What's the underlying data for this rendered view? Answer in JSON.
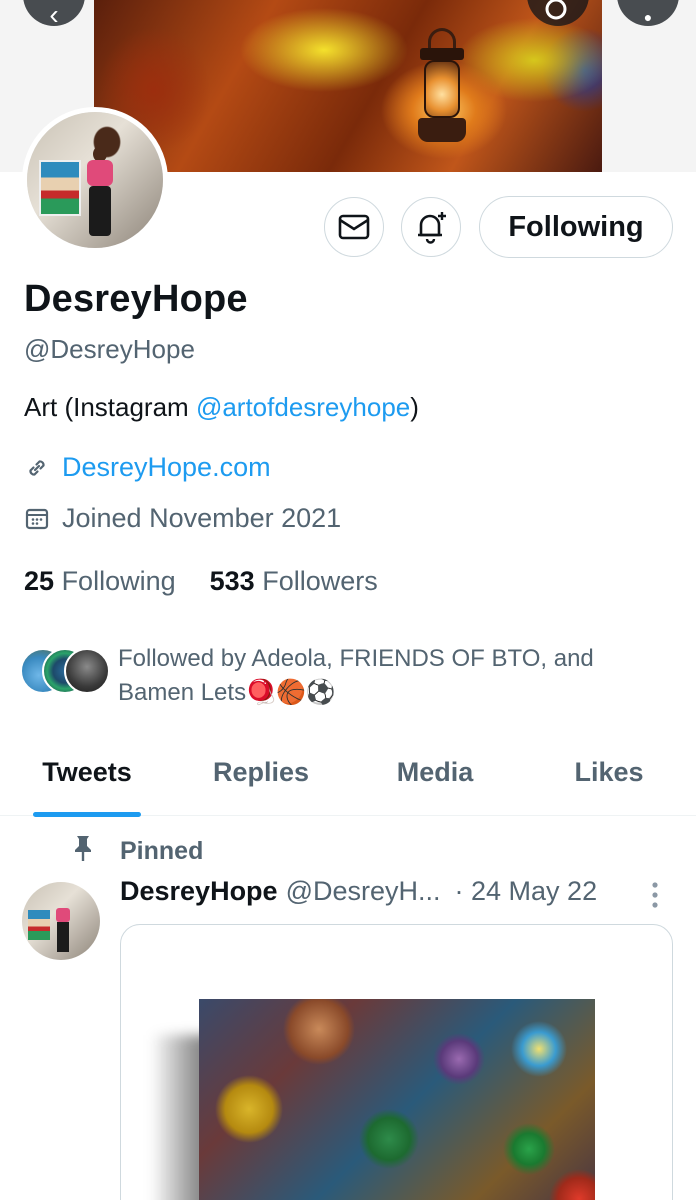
{
  "profile": {
    "display_name": "DesreyHope",
    "handle": "@DesreyHope",
    "bio_prefix": "Art (Instagram ",
    "bio_link": "@artofdesreyhope",
    "bio_suffix": ")",
    "website": "DesreyHope.com",
    "joined": "Joined November 2021",
    "following_count": "25",
    "following_label": "Following",
    "followers_count": "533",
    "followers_label": "Followers",
    "followed_by": "Followed by Adeola, FRIENDS OF BTO, and Bamen Lets🪀🏀⚽",
    "follow_button_label": "Following"
  },
  "icons": {
    "back": "back-arrow-icon",
    "search": "search-icon",
    "more": "more-icon",
    "message": "envelope-icon",
    "notify": "bell-plus-icon",
    "link": "link-icon",
    "calendar": "calendar-icon",
    "pin": "pin-icon",
    "tweet_more": "vertical-dots-icon"
  },
  "tabs": [
    {
      "label": "Tweets",
      "active": true
    },
    {
      "label": "Replies",
      "active": false
    },
    {
      "label": "Media",
      "active": false
    },
    {
      "label": "Likes",
      "active": false
    }
  ],
  "pinned_tweet": {
    "pinned_label": "Pinned",
    "author_name": "DesreyHope",
    "author_handle": "@DesreyH...",
    "date": "· 24 May 22"
  },
  "colors": {
    "accent": "#1d9bf0",
    "text_primary": "#0f1419",
    "text_secondary": "#536471",
    "border": "#cfd9de"
  }
}
